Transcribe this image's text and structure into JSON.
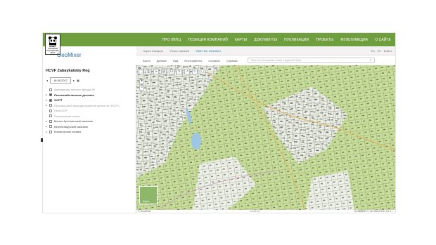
{
  "topnav": [
    "ПРО ЛВПЦ",
    "ПОЗИЦИЯ КОМПАНИЙ",
    "КАРТЫ",
    "ДОКУМЕНТЫ",
    "ПУБЛИКАЦИИ",
    "ПРОЕКТЫ",
    "МУЛЬТИМЕДИА",
    "О САЙТЕ"
  ],
  "logo": {
    "wwf": "WWF",
    "sub1": "СОХРАНИМ",
    "sub2": "РОССИЙСКИЕ",
    "sub3": "ЛЕСА"
  },
  "brand": "GeoMixer",
  "region": "HCVF Zabaykalskiy Reg",
  "subbar": {
    "tabs": [
      "Карта пожаров",
      "Поиск снимков",
      "Веб-ГИС GeoMixer"
    ],
    "active_index": 2,
    "right": [
      "Ru",
      "En",
      "Войти"
    ]
  },
  "toolbar": {
    "menus": [
      "Карта",
      "Данные",
      "Вид",
      "Инструменты",
      "Сервисы",
      "Справка"
    ],
    "search_placeholder": "Поиск по векторным слоям и адресной базе"
  },
  "date": "18.06.2017",
  "layers": [
    {
      "label": "Арендаторы лесного фонда ЗК",
      "checked": false,
      "bold": false,
      "faint": true
    },
    {
      "label": "Лесохозяйственное деление",
      "checked": true,
      "bold": true,
      "faint": false
    },
    {
      "label": "ООПТ",
      "checked": true,
      "bold": true,
      "faint": false
    },
    {
      "label": "Леса высокой природоохранной ценности (HCVF)",
      "checked": false,
      "bold": false,
      "faint": true
    },
    {
      "label": "Леса ООР",
      "checked": false,
      "bold": false,
      "faint": true
    },
    {
      "label": "Генеральная схема",
      "checked": false,
      "bold": false,
      "faint": true
    },
    {
      "label": "Малое Ароплинский заказник",
      "checked": false,
      "bold": false,
      "faint": false
    },
    {
      "label": "Верхнеамурский заказник",
      "checked": false,
      "bold": false,
      "faint": false
    },
    {
      "label": "Космические снимки",
      "checked": false,
      "bold": false,
      "faint": false
    }
  ],
  "minimap_label": "Карта",
  "footer": {
    "copyright": "© GeoMixer",
    "watermark": "GeoMixer",
    "coords": "51.888630 N, 112.893276 E  1:0 4 ..."
  }
}
